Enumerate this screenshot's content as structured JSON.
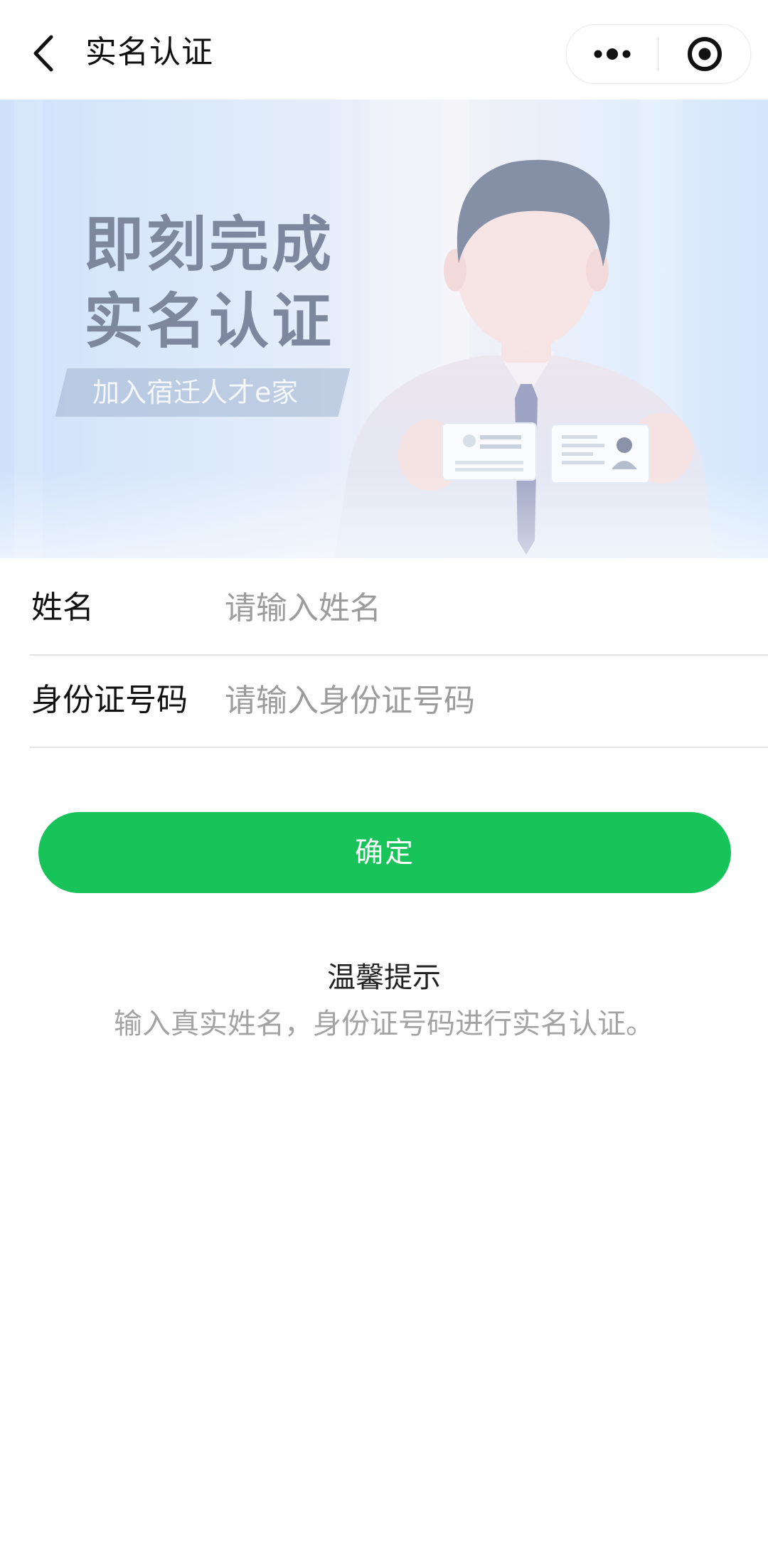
{
  "navbar": {
    "title": "实名认证",
    "back_icon": "chevron-left-icon",
    "more_icon": "more-dots-icon",
    "close_icon": "target-circle-icon"
  },
  "banner": {
    "headline_line1": "即刻完成",
    "headline_line2": "实名认证",
    "subtitle": "加入宿迁人才e家",
    "illustration": "person-holding-id-cards"
  },
  "form": {
    "name": {
      "label": "姓名",
      "placeholder": "请输入姓名",
      "value": ""
    },
    "id_number": {
      "label": "身份证号码",
      "placeholder": "请输入身份证号码",
      "value": ""
    }
  },
  "confirm_button": {
    "label": "确定"
  },
  "tips": {
    "title": "温馨提示",
    "body": "输入真实姓名，身份证号码进行实名认证。"
  },
  "colors": {
    "accent_green": "#18c45a",
    "banner_text": "#7d889f",
    "placeholder": "#9c9c9c",
    "tip_text": "#a3a3a3"
  }
}
